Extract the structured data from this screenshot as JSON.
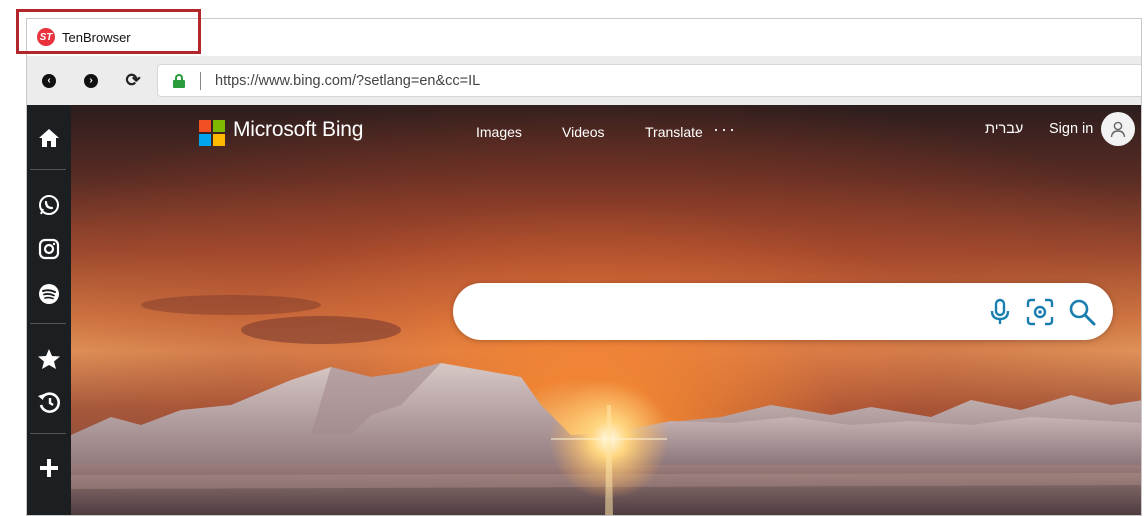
{
  "browser": {
    "tab_title": "TenBrowser",
    "url": "https://www.bing.com/?setlang=en&cc=IL"
  },
  "sidebar": {
    "items": [
      {
        "icon": "home-icon"
      },
      {
        "icon": "whatsapp-icon"
      },
      {
        "icon": "instagram-icon"
      },
      {
        "icon": "spotify-icon"
      },
      {
        "icon": "star-icon"
      },
      {
        "icon": "history-icon"
      },
      {
        "icon": "plus-icon"
      }
    ]
  },
  "bing": {
    "brand": "Microsoft Bing",
    "nav": [
      "Images",
      "Videos",
      "Translate"
    ],
    "more": "···",
    "language": "עברית",
    "sign_in": "Sign in",
    "search_placeholder": ""
  },
  "colors": {
    "highlight": "#b3262b",
    "lock": "#2a9c3b",
    "search_icons": "#1a7fb0",
    "ms_logo": [
      "#f25022",
      "#7fba00",
      "#00a4ef",
      "#ffb900"
    ]
  }
}
